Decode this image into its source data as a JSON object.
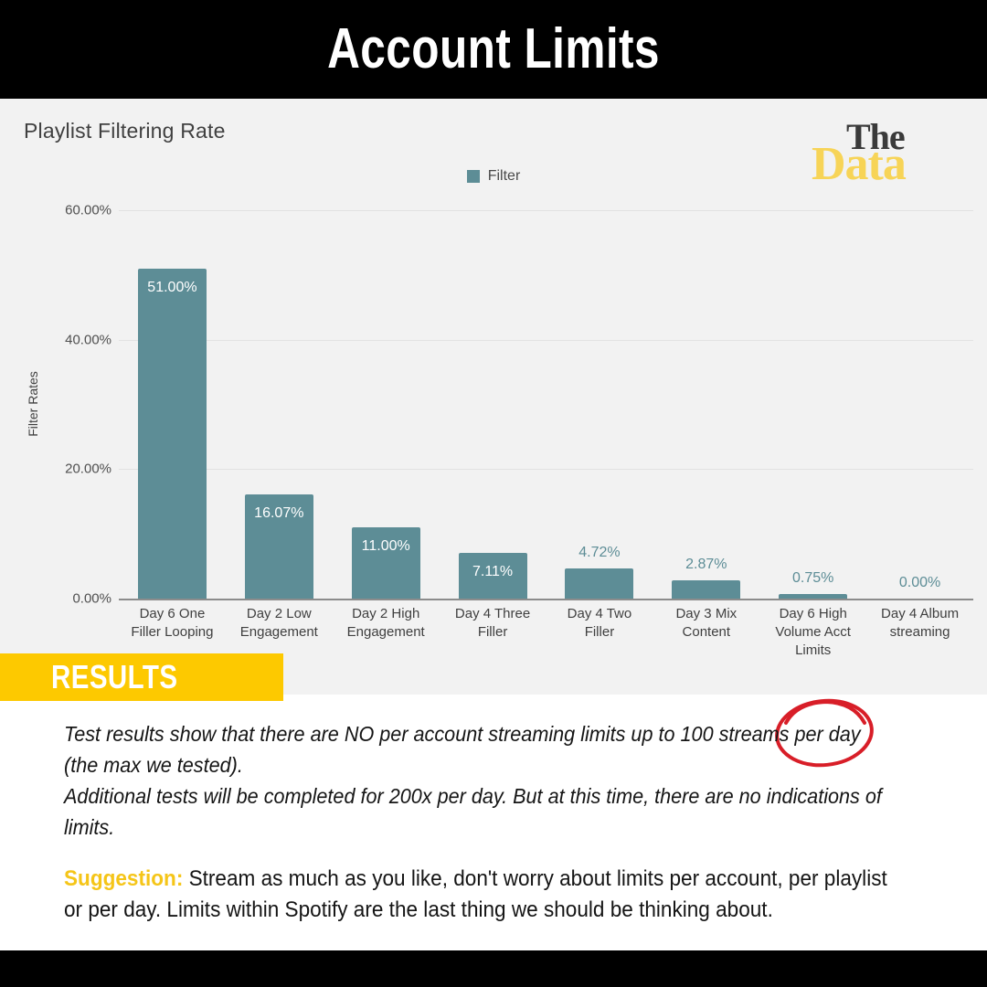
{
  "header": {
    "title": "Account Limits"
  },
  "logo": {
    "line1": "The",
    "line2": "Data"
  },
  "chart_data": {
    "type": "bar",
    "title": "Playlist Filtering Rate",
    "xlabel": "",
    "ylabel": "Filter Rates",
    "ylim": [
      0,
      60
    ],
    "grid": true,
    "legend_position": "top-center",
    "series": [
      {
        "name": "Filter",
        "color": "#5d8d96",
        "values": [
          51.0,
          16.07,
          11.0,
          7.11,
          4.72,
          2.87,
          0.75,
          0.0
        ]
      }
    ],
    "categories": [
      "Day 6 One Filler Looping",
      "Day 2 Low Engagement",
      "Day 2 High Engagement",
      "Day 4 Three Filler",
      "Day 4 Two Filler",
      "Day 3 Mix Content",
      "Day 6 High Volume Acct Limits",
      "Day 4 Album streaming"
    ],
    "category_lines": [
      [
        "Day 6 One",
        "Filler Looping"
      ],
      [
        "Day 2 Low",
        "Engagement"
      ],
      [
        "Day 2 High",
        "Engagement"
      ],
      [
        "Day 4 Three",
        "Filler"
      ],
      [
        "Day 4 Two",
        "Filler"
      ],
      [
        "Day 3 Mix",
        "Content"
      ],
      [
        "Day 6 High",
        "Volume Acct",
        "Limits"
      ],
      [
        "Day 4 Album",
        "streaming"
      ]
    ],
    "data_labels": [
      "51.00%",
      "16.07%",
      "11.00%",
      "7.11%",
      "4.72%",
      "2.87%",
      "0.75%",
      "0.00%"
    ],
    "ytick_labels": [
      "0.00%",
      "20.00%",
      "40.00%",
      "60.00%"
    ],
    "yticks": [
      0,
      20,
      40,
      60
    ],
    "annotation": {
      "shape": "ellipse",
      "color": "#d81e28",
      "target_category": "Day 6 High Volume Acct Limits"
    }
  },
  "legend": {
    "label": "Filter",
    "swatch_color": "#5d8d96"
  },
  "results": {
    "banner_label": "RESULTS",
    "banner_color": "#fdc900",
    "paragraph1": "Test results show that there are NO per account streaming limits up to 100 streams per day (the max we tested).",
    "paragraph2": "Additional tests will be completed for 200x per day. But at this time, there are no indications of limits.",
    "suggestion_label": "Suggestion:",
    "suggestion_text": " Stream as much as you like, don't worry about limits per account, per playlist or per day. Limits within Spotify are the last thing we should be thinking about."
  }
}
